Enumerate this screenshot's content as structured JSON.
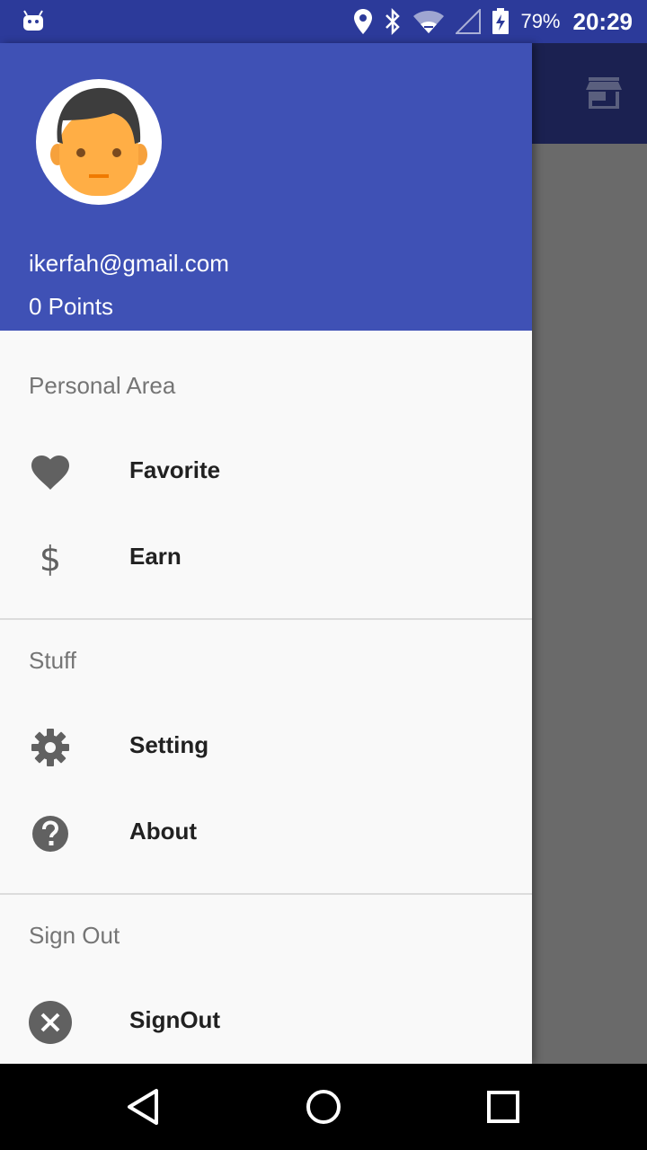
{
  "status_bar": {
    "battery_percent": "79%",
    "time": "20:29",
    "icons": [
      "android-icon",
      "location-icon",
      "bluetooth-icon",
      "wifi-icon",
      "cellular-signal-icon",
      "battery-charging-icon"
    ]
  },
  "app_bar": {
    "icon": "store-icon"
  },
  "drawer": {
    "header": {
      "avatar": "avatar",
      "email": "ikerfah@gmail.com",
      "points": "0 Points",
      "background": "#3f51b5"
    },
    "sections": [
      {
        "title": "Personal Area",
        "items": [
          {
            "label": "Favorite",
            "icon": "heart-icon"
          },
          {
            "label": "Earn",
            "icon": "dollar-icon"
          }
        ]
      },
      {
        "title": "Stuff",
        "items": [
          {
            "label": "Setting",
            "icon": "gear-icon"
          },
          {
            "label": "About",
            "icon": "help-icon"
          }
        ]
      },
      {
        "title": "Sign Out",
        "items": [
          {
            "label": "SignOut",
            "icon": "close-circle-icon"
          }
        ]
      }
    ]
  },
  "nav_bar": {
    "buttons": [
      "back-icon",
      "home-icon",
      "recents-icon"
    ]
  },
  "colors": {
    "status_bar": "#2c3a9a",
    "primary": "#3f51b5",
    "scrim": "#6b6b6b"
  }
}
